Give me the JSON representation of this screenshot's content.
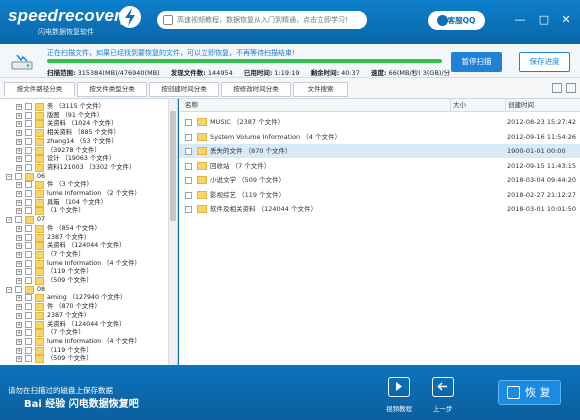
{
  "app": {
    "logo_text": "speedrecovery",
    "logo_subtitle": "闪电数据恢复软件",
    "notice": "高速视频教程，数据恢复从入门到精通，点击立即学习!",
    "qq_label": "客服QQ",
    "window_buttons": [
      "—",
      "□",
      "✕"
    ]
  },
  "status": {
    "message": "正在扫描文件，如果已经找到要恢复的文件，可以立即恢复，不再等待扫描结束!",
    "progress_percent": 100,
    "scan_range_label": "扫描范围:",
    "scan_range_value": "315384(MB)/476940(MB)",
    "files_found_label": "发现文件数:",
    "files_found_value": "144954",
    "elapsed_label": "已用时间:",
    "elapsed_value": "1:19:19",
    "remaining_label": "剩余时间:",
    "remaining_value": "40:37",
    "speed_label": "速度:",
    "speed_value": "66(MB/秒) 3(GB)/分",
    "pause_button": "暂停扫描",
    "save_button": "保存进度"
  },
  "tabs": [
    {
      "label": "按文件路径分类",
      "active": true
    },
    {
      "label": "按文件类型分类",
      "active": false
    },
    {
      "label": "按创建时间分类",
      "active": false
    },
    {
      "label": "按修改时间分类",
      "active": false
    },
    {
      "label": "文件搜索",
      "active": false
    }
  ],
  "tree": [
    {
      "text": "务 （3115 个文件）"
    },
    {
      "text": "版图 （91 个文件）"
    },
    {
      "text": "关资料 （1024 个文件）"
    },
    {
      "text": "相关资料 （885 个文件）"
    },
    {
      "text": "zhang14 （53 个文件）"
    },
    {
      "text": "（39278 个文件）"
    },
    {
      "text": "设计 （19063 个文件）"
    },
    {
      "text": "资料121003 （3302 个文件）"
    },
    {
      "text": "06"
    },
    {
      "text": "件 （3 个文件）"
    },
    {
      "text": "lume Information （2 个文件）"
    },
    {
      "text": "具箱 （104 个文件）"
    },
    {
      "text": "（1 个文件）"
    },
    {
      "text": "07"
    },
    {
      "text": "件 （854 个文件）"
    },
    {
      "text": "2387 个文件）"
    },
    {
      "text": "关资料 （124044 个文件）"
    },
    {
      "text": "（7 个文件）"
    },
    {
      "text": "lume Information （4 个文件）"
    },
    {
      "text": "（119 个文件）"
    },
    {
      "text": "（509 个文件）"
    },
    {
      "text": "08"
    },
    {
      "text": "aming （127940 个文件）"
    },
    {
      "text": "件 （870 个文件）"
    },
    {
      "text": "2387 个文件）"
    },
    {
      "text": "关资料 （124044 个文件）"
    },
    {
      "text": "（7 个文件）"
    },
    {
      "text": "lume Information （4 个文件）"
    },
    {
      "text": "（119 个文件）"
    },
    {
      "text": "（509 个文件）"
    }
  ],
  "columns": {
    "name": "名称",
    "size": "大小",
    "created": "创建时间"
  },
  "files": [
    {
      "name": "MUSIC （2387 个文件）",
      "date": "2012-08-23 15:27:42",
      "selected": false
    },
    {
      "name": "System Volume Information （4 个文件）",
      "date": "2012-09-16 11:54:26",
      "selected": false
    },
    {
      "name": "丢失的文件 （870 个文件）",
      "date": "1900-01-01 00:00",
      "selected": true
    },
    {
      "name": "回收站 （7 个文件）",
      "date": "2012-09-15 11:43:15",
      "selected": false
    },
    {
      "name": "小说文学 （509 个文件）",
      "date": "2018-03-04 09:44:20",
      "selected": false
    },
    {
      "name": "影视综艺 （119 个文件）",
      "date": "2018-02-27 21:12:27",
      "selected": false
    },
    {
      "name": "软件及相关资料 （124044 个文件）",
      "date": "2018-03-01 10:01:50",
      "selected": false
    }
  ],
  "footer": {
    "watermark_line1": "请勿在扫描过的磁盘上保存数据",
    "watermark_line2": "Bai 经验 闪电数据恢复吧",
    "video_label": "视频教程",
    "back_label": "上一步",
    "restore_label": "恢 复"
  }
}
